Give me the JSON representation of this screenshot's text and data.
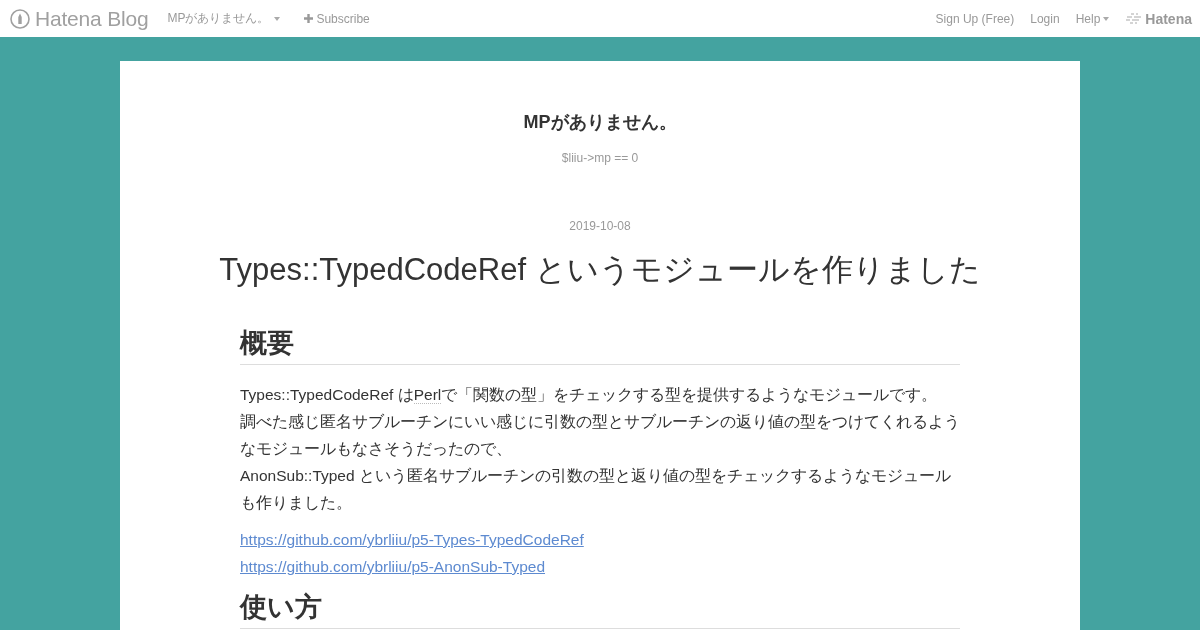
{
  "header": {
    "logo": "Hatena Blog",
    "blog_menu": "MPがありません。",
    "subscribe": "Subscribe",
    "nav": [
      {
        "label": "Sign Up (Free)",
        "kind": "link"
      },
      {
        "label": "Login",
        "kind": "link"
      },
      {
        "label": "Help",
        "kind": "menu"
      }
    ],
    "brand": "Hatena"
  },
  "blog": {
    "title": "MPがありません。",
    "description": "$liiu->mp == 0"
  },
  "entry": {
    "date": "2019-10-08",
    "title": "Types::TypedCodeRef というモジュールを作りました",
    "sections": [
      {
        "heading": "概要",
        "lines": [
          [
            {
              "kind": "text",
              "text": "Types::TypedCodeRef は"
            },
            {
              "kind": "keyword",
              "text": "Perl"
            },
            {
              "kind": "text",
              "text": "で「関数の型」をチェックする型を提供するようなモジュールです。"
            }
          ],
          [
            {
              "kind": "text",
              "text": "調べた感じ匿名サブルーチンにいい感じに引数の型とサブルーチンの返り値の型をつけてくれるようなモジュールもなさそうだったので、"
            }
          ],
          [
            {
              "kind": "text",
              "text": "AnonSub::Typed という匿名サブルーチンの引数の型と返り値の型をチェックするようなモジュールも作りました。"
            }
          ]
        ],
        "links": [
          "https://github.com/ybrliiu/p5-Types-TypedCodeRef",
          "https://github.com/ybrliiu/p5-AnonSub-Typed"
        ]
      },
      {
        "heading": "使い方"
      }
    ]
  }
}
